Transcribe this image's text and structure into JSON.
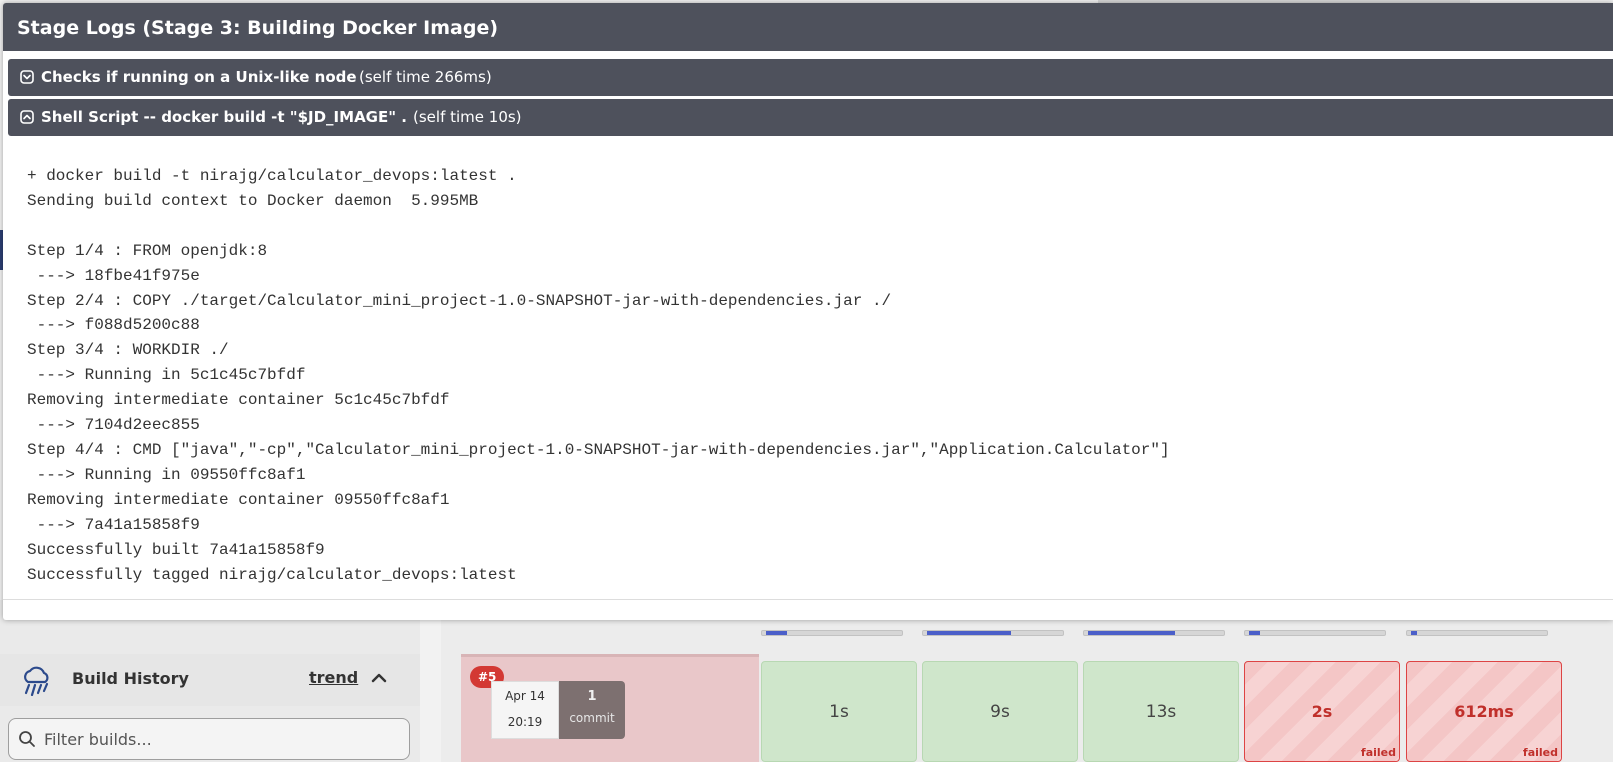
{
  "modal": {
    "title": "Stage Logs (Stage 3: Building Docker Image)",
    "steps": [
      {
        "title": "Checks if running on a Unix-like node",
        "self_time": "(self time 266ms)",
        "toggle_icon": "expand-icon",
        "expanded": false
      },
      {
        "title": "Shell Script -- docker build -t \"$JD_IMAGE\" .",
        "self_time": "(self time 10s)",
        "toggle_icon": "collapse-icon",
        "expanded": true
      }
    ],
    "log_lines": [
      "+ docker build -t nirajg/calculator_devops:latest .",
      "Sending build context to Docker daemon  5.995MB",
      "",
      "Step 1/4 : FROM openjdk:8",
      " ---> 18fbe41f975e",
      "Step 2/4 : COPY ./target/Calculator_mini_project-1.0-SNAPSHOT-jar-with-dependencies.jar ./",
      " ---> f088d5200c88",
      "Step 3/4 : WORKDIR ./",
      " ---> Running in 5c1c45c7bfdf",
      "Removing intermediate container 5c1c45c7bfdf",
      " ---> 7104d2eec855",
      "Step 4/4 : CMD [\"java\",\"-cp\",\"Calculator_mini_project-1.0-SNAPSHOT-jar-with-dependencies.jar\",\"Application.Calculator\"]",
      " ---> Running in 09550ffc8af1",
      "Removing intermediate container 09550ffc8af1",
      " ---> 7a41a15858f9",
      "Successfully built 7a41a15858f9",
      "Successfully tagged nirajg/calculator_devops:latest"
    ]
  },
  "sidebar": {
    "build_history": {
      "icon": "weather-rain-icon",
      "title": "Build History",
      "trend_label": "trend",
      "toggle_icon": "chevron-up-icon",
      "filter_placeholder": "Filter builds..."
    }
  },
  "stage_view": {
    "stage_progress": [
      0.15,
      0.6,
      0.62,
      0.08,
      0.04
    ],
    "build": {
      "number": "#5",
      "date": "Apr 14",
      "time": "20:19",
      "commit_count": "1",
      "commit_label": "commit",
      "stages": [
        {
          "duration": "1s",
          "status": "success"
        },
        {
          "duration": "9s",
          "status": "success"
        },
        {
          "duration": "13s",
          "status": "success"
        },
        {
          "duration": "2s",
          "status": "failed",
          "status_label": "failed"
        },
        {
          "duration": "612ms",
          "status": "failed",
          "status_label": "failed"
        }
      ]
    }
  },
  "colors": {
    "modal_header": "#4e515c",
    "failed": "#c0302b",
    "success_cell": "#cfe6cb",
    "build_badge": "#d33833",
    "progress_fill": "#4b5fc9"
  }
}
